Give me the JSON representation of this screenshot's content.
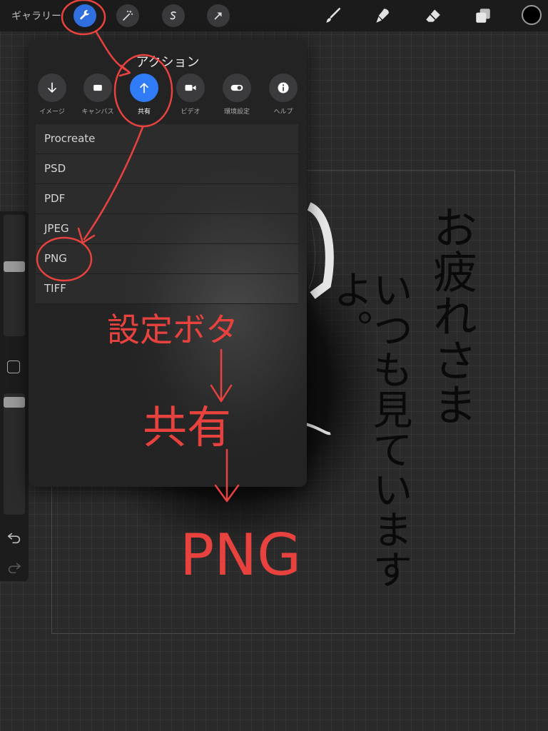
{
  "topbar": {
    "gallery_label": "ギャラリー",
    "left_tools": [
      "wrench-icon",
      "magic-wand-icon",
      "selection-icon",
      "transform-arrow-icon"
    ],
    "right_tools": [
      "brush-icon",
      "smudge-icon",
      "eraser-icon",
      "layers-icon"
    ],
    "current_color": "#000000"
  },
  "panel": {
    "title": "アクション",
    "tabs": [
      {
        "label": "イメージ",
        "icon": "arrow-down-icon"
      },
      {
        "label": "キャンバス",
        "icon": "canvas-icon"
      },
      {
        "label": "共有",
        "icon": "share-arrow-up-icon",
        "active": true
      },
      {
        "label": "ビデオ",
        "icon": "video-camera-icon"
      },
      {
        "label": "環境設定",
        "icon": "toggle-icon"
      },
      {
        "label": "ヘルプ",
        "icon": "info-icon"
      }
    ],
    "export_formats": [
      "Procreate",
      "PSD",
      "PDF",
      "JPEG",
      "PNG",
      "TIFF"
    ]
  },
  "annotation": {
    "line1": "設定ボタ",
    "line2": "共有",
    "line3": "PNG",
    "color": "#e8423f"
  },
  "artwork_text": {
    "col1": "お疲れさま",
    "col2": "いつも見ていますよ。"
  },
  "colors": {
    "accent": "#2f7cf6",
    "background": "#2a2a2b",
    "panel": "#232324"
  }
}
